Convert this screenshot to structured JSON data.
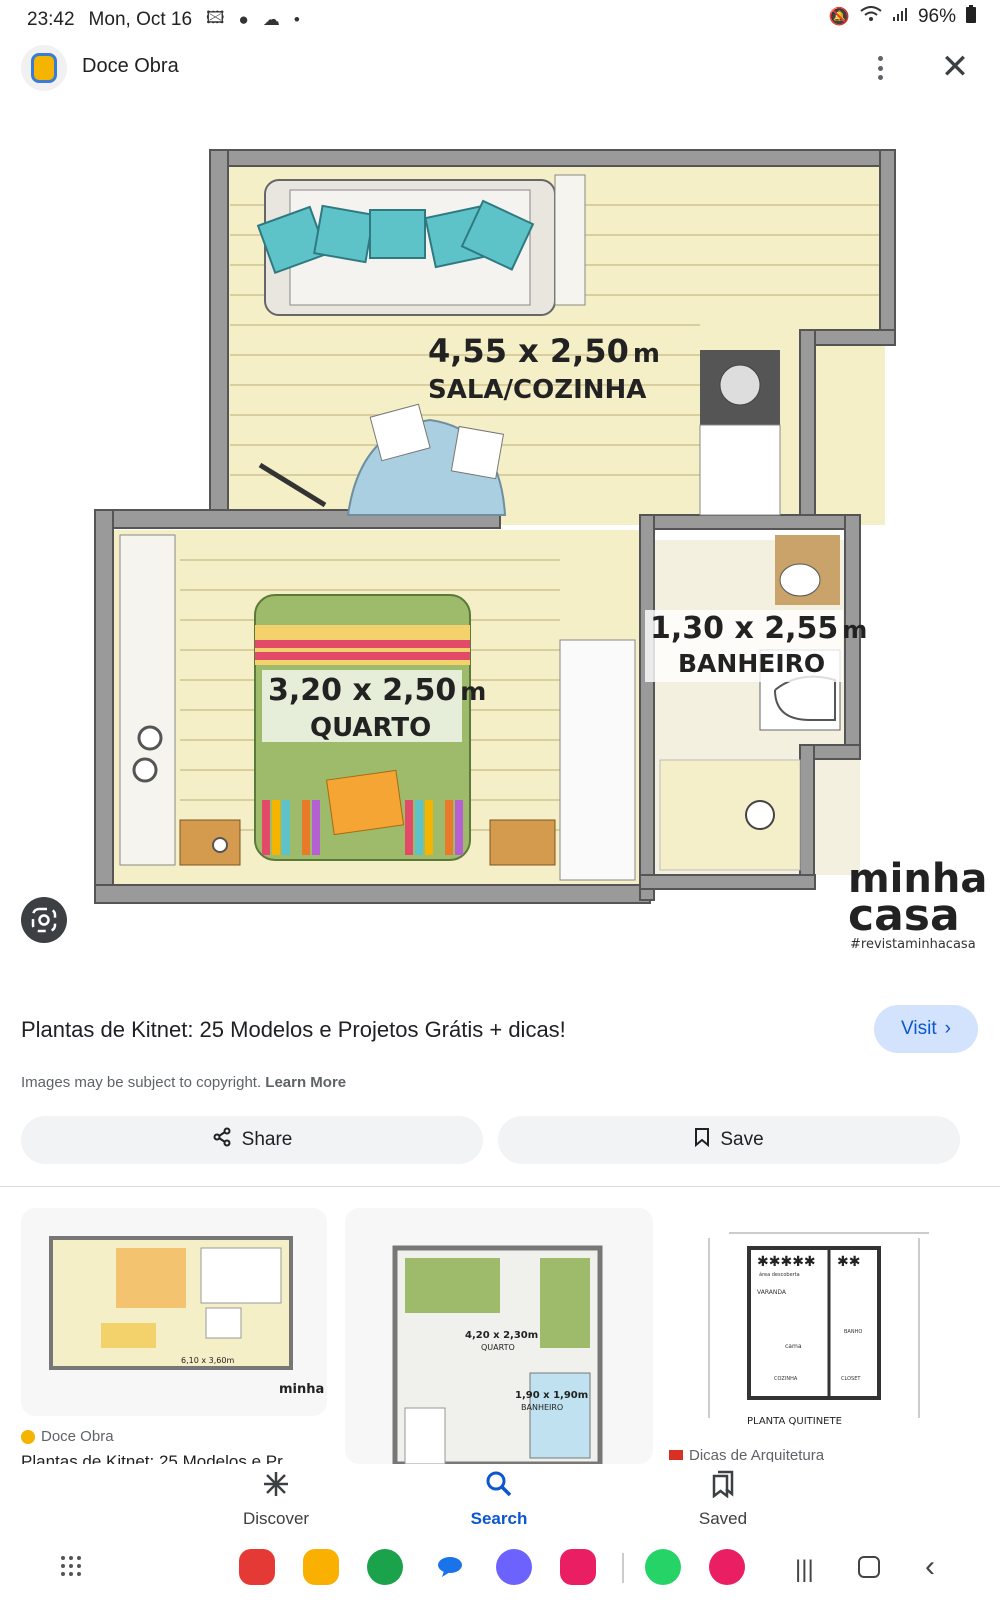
{
  "status_bar": {
    "time": "23:42",
    "date": "Mon, Oct 16",
    "battery": "96%",
    "left_icons": [
      "gallery-icon",
      "bulb-icon",
      "cloud-icon",
      "dot-icon"
    ],
    "right_icons": [
      "mute-icon",
      "wifi-icon",
      "signal-icon",
      "battery-icon"
    ]
  },
  "header": {
    "site_name": "Doce Obra",
    "menu_icon": "more-vert-icon",
    "close_icon": "close-icon"
  },
  "floorplan": {
    "living": {
      "dims": "4,55 x 2,50",
      "unit": "m",
      "name": "SALA/COZINHA"
    },
    "bedroom": {
      "dims": "3,20 x 2,50",
      "unit": "m",
      "name": "QUARTO"
    },
    "bathroom": {
      "dims": "1,30 x 2,55",
      "unit": "m",
      "name": "BANHEIRO"
    },
    "brand_line1": "minha",
    "brand_line2": "casa",
    "brand_tag": "#revistaminhacasa"
  },
  "result": {
    "title": "Plantas de Kitnet: 25 Modelos e Projetos Grátis + dicas!",
    "visit_label": "Visit",
    "copyright": "Images may be subject to copyright.",
    "learn_more": "Learn More",
    "share_label": "Share",
    "save_label": "Save"
  },
  "related": [
    {
      "source": "Doce Obra",
      "title": "Plantas de Kitnet: 25 Modelos e Pr",
      "thumb_text": "6,10 x 3,60m",
      "thumb_brand": "minha casa"
    },
    {
      "source": "",
      "title": "",
      "thumb_room1": "4,20 x 2,30m",
      "thumb_room1_name": "QUARTO",
      "thumb_room2": "1,90 x 1,90m",
      "thumb_room2_name": "BANHEIRO"
    },
    {
      "source": "Dicas de Arquitetura",
      "title": "",
      "thumb_label_top1": "VARANDA",
      "thumb_label_top2": "área descoberta",
      "thumb_cama": "cama",
      "thumb_cozinha": "COZINHA",
      "thumb_closet": "CLOSET",
      "thumb_banho": "BANHO",
      "thumb_caption": "PLANTA QUITINETE"
    }
  ],
  "bottom_nav": [
    {
      "label": "Discover",
      "icon": "asterisk-icon"
    },
    {
      "label": "Search",
      "icon": "search-icon",
      "active": true
    },
    {
      "label": "Saved",
      "icon": "bookmarks-icon"
    }
  ],
  "dock": {
    "apps": [
      "flipboard-app",
      "files-app",
      "c-app",
      "messages-app",
      "orbit-app",
      "camera-app",
      "whatsapp-app",
      "flower-app"
    ],
    "nav": [
      "recents-icon",
      "home-icon",
      "back-icon"
    ]
  },
  "colors": {
    "accent": "#0b57d0",
    "visit_bg": "#d3e3fd",
    "chip_bg": "#f1f3f4"
  }
}
